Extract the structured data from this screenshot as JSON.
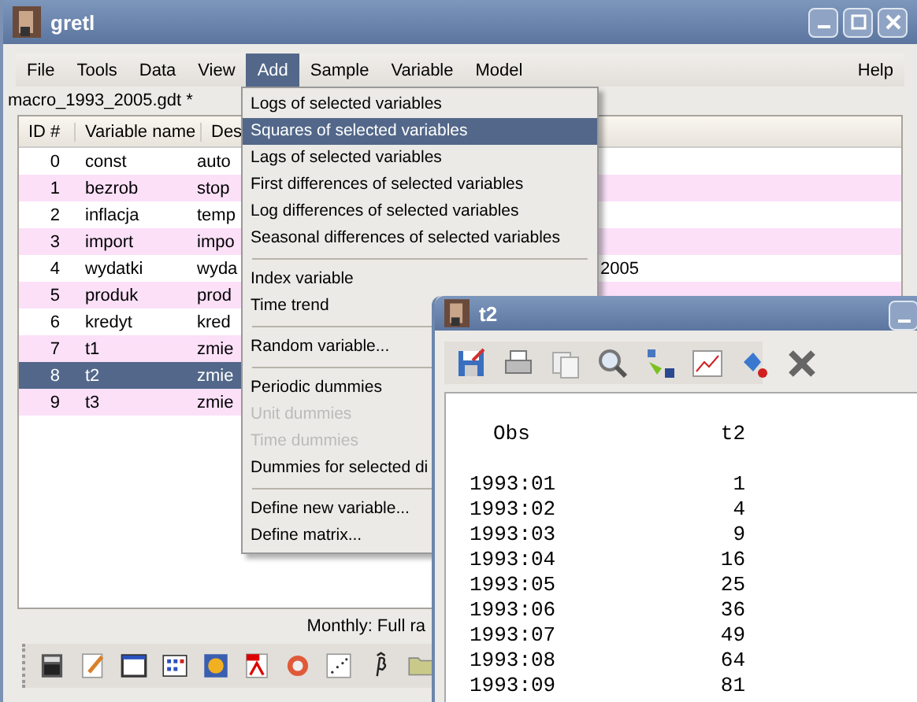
{
  "window": {
    "title": "gretl"
  },
  "menubar": [
    {
      "label": "File",
      "selected": false
    },
    {
      "label": "Tools",
      "selected": false
    },
    {
      "label": "Data",
      "selected": false
    },
    {
      "label": "View",
      "selected": false
    },
    {
      "label": "Add",
      "selected": true
    },
    {
      "label": "Sample",
      "selected": false
    },
    {
      "label": "Variable",
      "selected": false
    },
    {
      "label": "Model",
      "selected": false
    },
    {
      "label": "Help",
      "selected": false
    }
  ],
  "dataset_label": "macro_1993_2005.gdt *",
  "table": {
    "columns": [
      "ID #",
      "Variable name",
      "Des"
    ],
    "rows": [
      {
        "id": "0",
        "name": "const",
        "description": "auto",
        "selected": false
      },
      {
        "id": "1",
        "name": "bezrob",
        "description": "stop",
        "selected": false
      },
      {
        "id": "2",
        "name": "inflacja",
        "description": "temp",
        "selected": false
      },
      {
        "id": "3",
        "name": "import",
        "description": "impo",
        "selected": false
      },
      {
        "id": "4",
        "name": "wydatki",
        "description": "wyda",
        "description_end": "2005",
        "selected": false
      },
      {
        "id": "5",
        "name": "produk",
        "description": "prod",
        "selected": false
      },
      {
        "id": "6",
        "name": "kredyt",
        "description": "kred",
        "selected": false
      },
      {
        "id": "7",
        "name": "t1",
        "description": "zmie",
        "selected": false
      },
      {
        "id": "8",
        "name": "t2",
        "description": "zmie",
        "selected": true
      },
      {
        "id": "9",
        "name": "t3",
        "description": "zmie",
        "selected": false
      }
    ]
  },
  "status_bar": "Monthly: Full ra",
  "add_menu": [
    {
      "kind": "item",
      "label": "Logs of selected variables",
      "selected": false,
      "disabled": false
    },
    {
      "kind": "item",
      "label": "Squares of selected variables",
      "selected": true,
      "disabled": false
    },
    {
      "kind": "item",
      "label": "Lags of selected variables",
      "selected": false,
      "disabled": false
    },
    {
      "kind": "item",
      "label": "First differences of selected variables",
      "selected": false,
      "disabled": false
    },
    {
      "kind": "item",
      "label": "Log differences of selected variables",
      "selected": false,
      "disabled": false
    },
    {
      "kind": "item",
      "label": "Seasonal differences of selected variables",
      "selected": false,
      "disabled": false
    },
    {
      "kind": "separator"
    },
    {
      "kind": "item",
      "label": "Index variable",
      "selected": false,
      "disabled": false
    },
    {
      "kind": "item",
      "label": "Time trend",
      "selected": false,
      "disabled": false
    },
    {
      "kind": "separator"
    },
    {
      "kind": "item",
      "label": "Random variable...",
      "selected": false,
      "disabled": false
    },
    {
      "kind": "separator"
    },
    {
      "kind": "item",
      "label": "Periodic dummies",
      "selected": false,
      "disabled": false
    },
    {
      "kind": "item",
      "label": "Unit dummies",
      "selected": false,
      "disabled": true
    },
    {
      "kind": "item",
      "label": "Time dummies",
      "selected": false,
      "disabled": true
    },
    {
      "kind": "item",
      "label": "Dummies for selected di",
      "selected": false,
      "disabled": false
    },
    {
      "kind": "separator"
    },
    {
      "kind": "item",
      "label": "Define new variable...",
      "selected": false,
      "disabled": false
    },
    {
      "kind": "item",
      "label": "Define matrix...",
      "selected": false,
      "disabled": false
    }
  ],
  "data_window": {
    "title": "t2",
    "header": [
      "Obs",
      "t2"
    ],
    "rows": [
      [
        "1993:01",
        "1"
      ],
      [
        "1993:02",
        "4"
      ],
      [
        "1993:03",
        "9"
      ],
      [
        "1993:04",
        "16"
      ],
      [
        "1993:05",
        "25"
      ],
      [
        "1993:06",
        "36"
      ],
      [
        "1993:07",
        "49"
      ],
      [
        "1993:08",
        "64"
      ],
      [
        "1993:09",
        "81"
      ]
    ]
  }
}
